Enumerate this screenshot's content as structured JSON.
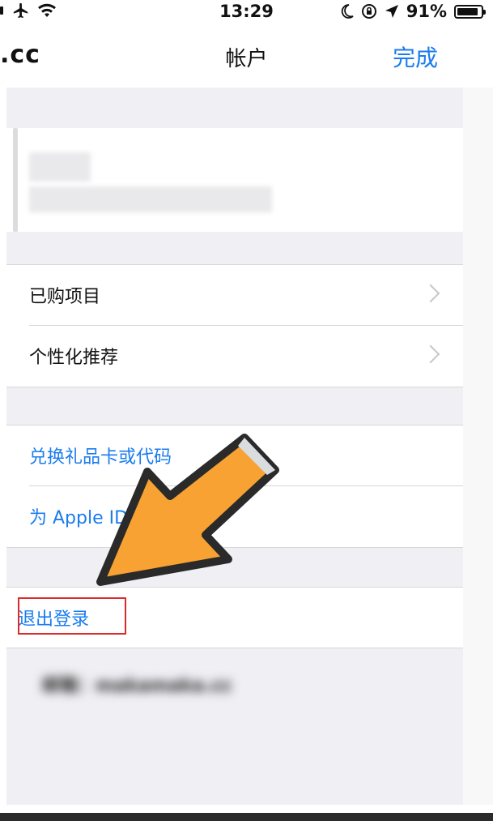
{
  "status_bar": {
    "time": "13:29",
    "battery_percent": "91%",
    "battery_level": 0.91,
    "icons": [
      "airplane-icon",
      "wifi-icon",
      "moon-icon",
      "rotation-lock-icon",
      "location-icon",
      "battery-icon"
    ]
  },
  "nav": {
    "left_text": ".cc",
    "title": "帐户",
    "done_label": "完成"
  },
  "menu": {
    "purchased": "已购项目",
    "recommendations": "个性化推荐",
    "redeem": "兑换礼品卡或代码",
    "add_funds": "为 Apple ID"
  },
  "sign_out": "退出登录",
  "footer": "邮箱：makamaka.cc",
  "colors": {
    "accent": "#1a7cf0",
    "highlight_box": "#d92b2b",
    "arrow_fill": "#f7a233",
    "group_background": "#efeff4"
  }
}
